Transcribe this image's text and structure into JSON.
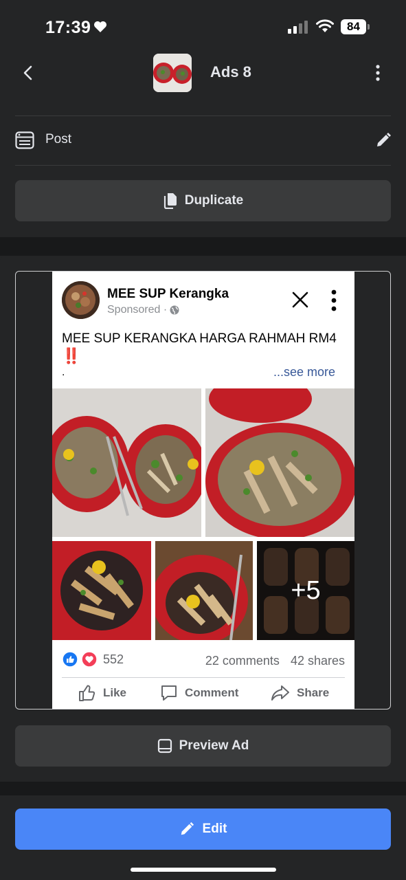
{
  "status_bar": {
    "time": "17:39",
    "battery": "84"
  },
  "header": {
    "title": "Ads 8"
  },
  "post_row": {
    "label": "Post"
  },
  "duplicate_button": {
    "label": "Duplicate"
  },
  "ad_preview": {
    "page_name": "MEE SUP Kerangka",
    "sponsored": "Sponsored ·",
    "text": "MEE SUP KERANGKA HARGA RAHMAH RM4",
    "emoji": "‼️",
    "dot": ".",
    "see_more": "...see more",
    "more_photos": "+5",
    "reaction_count": "552",
    "comments": "22 comments",
    "shares": "42 shares",
    "actions": {
      "like": "Like",
      "comment": "Comment",
      "share": "Share"
    }
  },
  "preview_button": {
    "label": "Preview Ad"
  },
  "edit_button": {
    "label": "Edit"
  },
  "colors": {
    "background": "#242526",
    "accent": "#4a86f7",
    "button": "#3a3b3c"
  },
  "icons": [
    "heart-icon",
    "signal-icon",
    "wifi-icon",
    "battery-icon",
    "back-chevron-icon",
    "more-vertical-icon",
    "post-icon",
    "pencil-icon",
    "duplicate-icon",
    "globe-icon",
    "close-icon",
    "like-icon",
    "love-icon",
    "thumbs-up-icon",
    "comment-icon",
    "share-icon",
    "preview-icon",
    "edit-icon"
  ]
}
